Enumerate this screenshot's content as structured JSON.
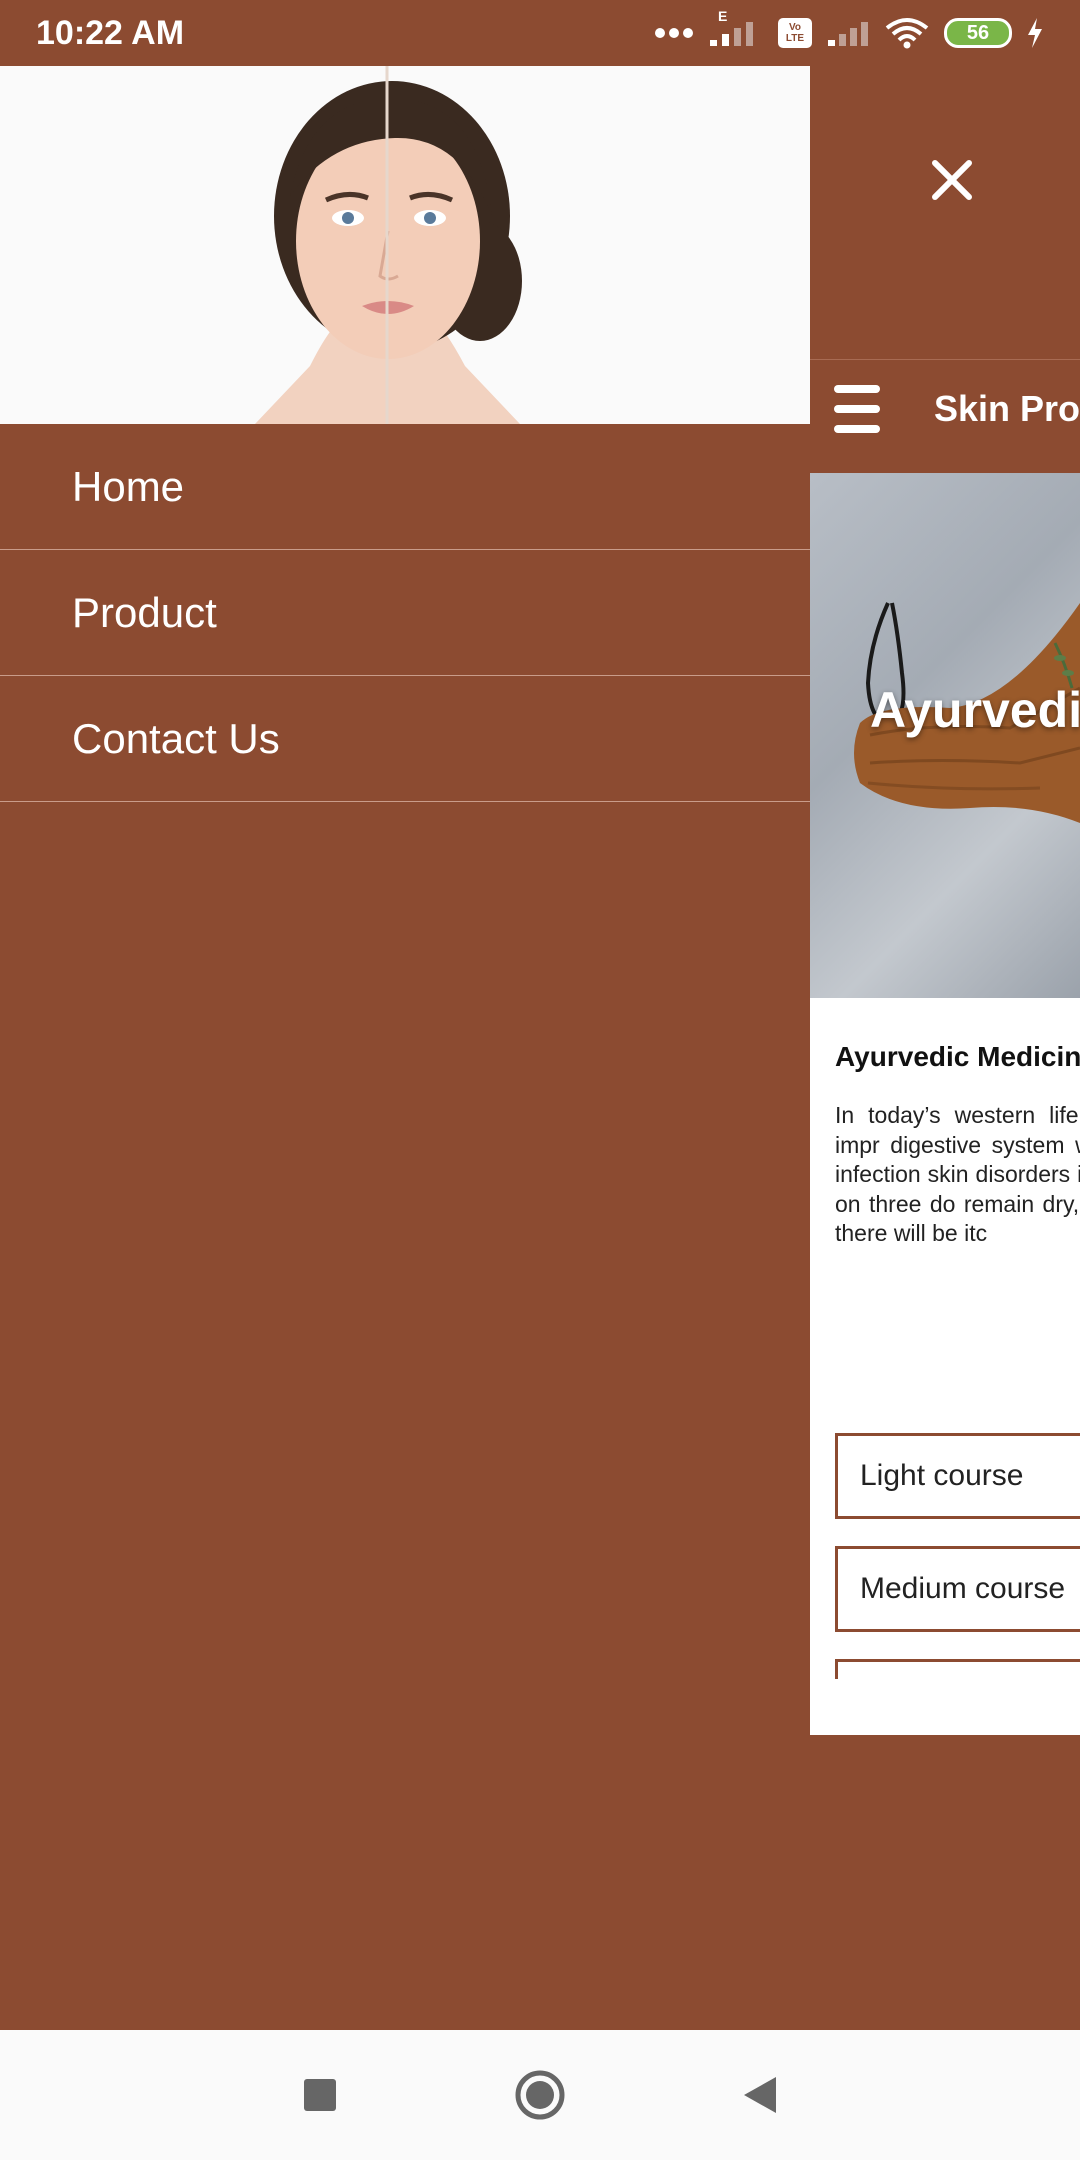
{
  "status_bar": {
    "time": "10:22 AM",
    "battery": "56",
    "network_indicator": "E",
    "volte_label": "Vo LTE"
  },
  "drawer": {
    "menu_items": [
      {
        "label": "Home"
      },
      {
        "label": "Product"
      },
      {
        "label": "Contact Us"
      }
    ]
  },
  "appbar": {
    "title": "Skin Pro"
  },
  "banner": {
    "text": "Ayurvedic"
  },
  "article": {
    "title": "Ayurvedic Medicin",
    "body": "In today’s western life food habits and impr digestive system whic which create infection skin disorders in our b are based on three do remain dry, in Pitta do dosha there will be itc"
  },
  "courses": [
    {
      "label": "Light course"
    },
    {
      "label": "Medium course"
    }
  ],
  "colors": {
    "brand": "#8c4b31",
    "surface": "#ffffff"
  },
  "icons": {
    "close": "close-icon",
    "menu": "hamburger-menu-icon",
    "nav_recents": "square-icon",
    "nav_home": "circle-icon",
    "nav_back": "triangle-back-icon"
  }
}
